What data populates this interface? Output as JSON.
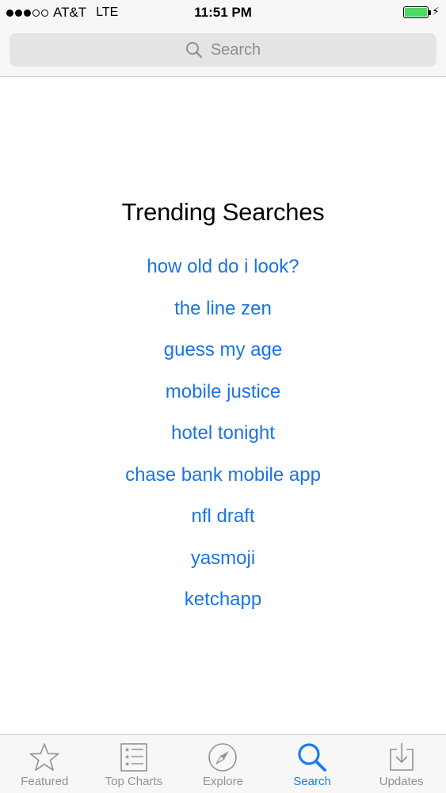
{
  "status_bar": {
    "carrier": "AT&T",
    "network": "LTE",
    "time": "11:51 PM",
    "signal_bars_filled": 3,
    "signal_bars_total": 5,
    "battery_level": 1.0,
    "charging_icon": "⚡"
  },
  "search": {
    "placeholder": "Search"
  },
  "trending": {
    "title": "Trending Searches",
    "items": [
      "how old do i look?",
      "the line zen",
      "guess my age",
      "mobile justice",
      "hotel tonight",
      "chase bank mobile app",
      "nfl draft",
      "yasmoji",
      "ketchapp"
    ]
  },
  "tab_bar": {
    "active_tab": "Search",
    "tabs": [
      {
        "label": "Featured",
        "icon": "star-icon"
      },
      {
        "label": "Top Charts",
        "icon": "list-icon"
      },
      {
        "label": "Explore",
        "icon": "compass-icon"
      },
      {
        "label": "Search",
        "icon": "search-icon"
      },
      {
        "label": "Updates",
        "icon": "download-icon"
      }
    ]
  },
  "colors": {
    "link_blue": "#1a73e8",
    "active_tab_blue": "#1a7bf2",
    "inactive_tab_gray": "#929292",
    "battery_green": "#4cd964"
  }
}
